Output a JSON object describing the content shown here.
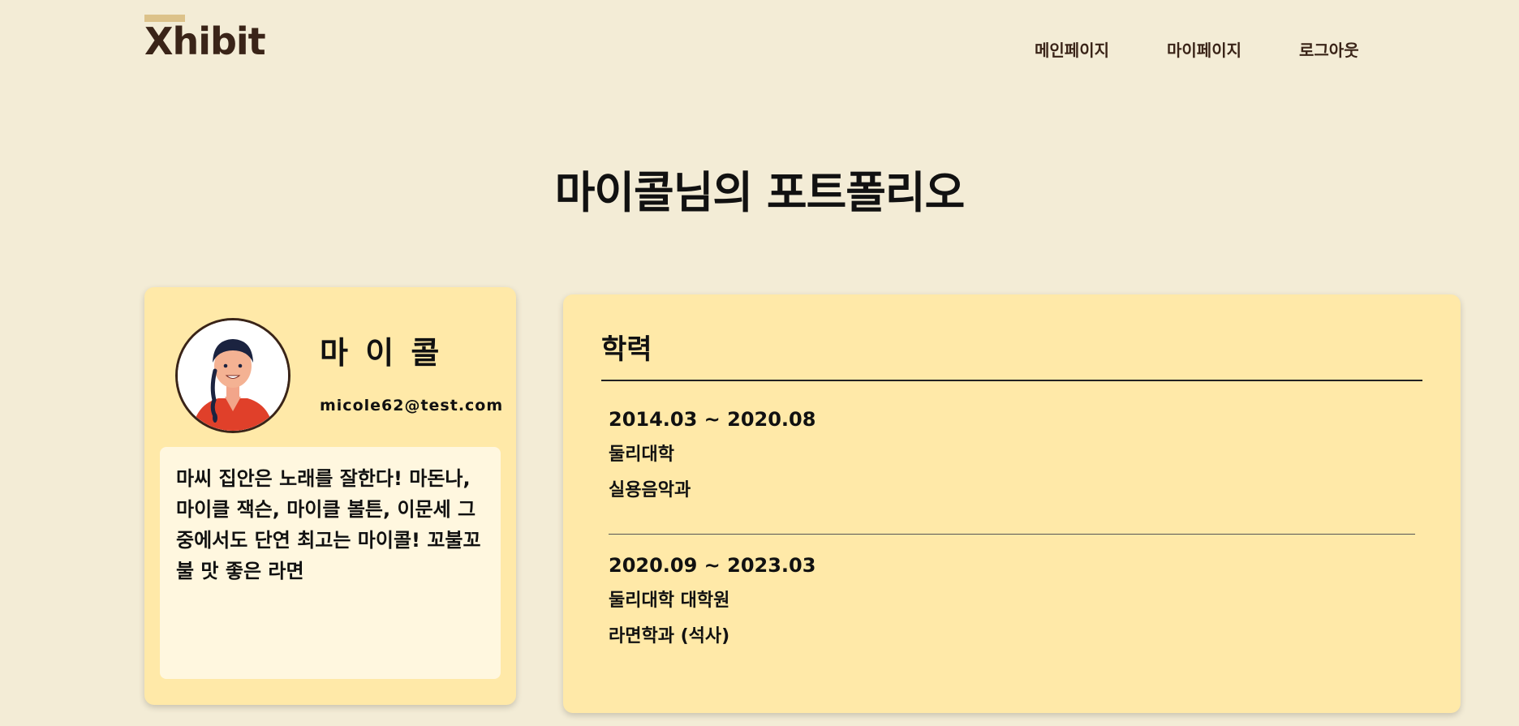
{
  "header": {
    "logo_text": "Xhibit",
    "nav": [
      "메인페이지",
      "마이페이지",
      "로그아웃"
    ]
  },
  "page_title": "마이콜님의 포트폴리오",
  "profile": {
    "name": "마 이 콜",
    "email": "micole62@test.com",
    "bio": "마씨 집안은 노래를 잘한다! 마돈나, 마이클 잭슨, 마이클 볼튼, 이문세 그 중에서도 단연 최고는 마이콜! 꼬불꼬불 맛 좋은 라면"
  },
  "education": {
    "title": "학력",
    "entries": [
      {
        "period": "2014.03 ~ 2020.08",
        "school": "둘리대학",
        "major": "실용음악과"
      },
      {
        "period": "2020.09 ~ 2023.03",
        "school": "둘리대학 대학원",
        "major": "라면학과 (석사)"
      }
    ]
  },
  "colors": {
    "background": "#f3ecd6",
    "card": "#ffe9a8",
    "bio_box": "#fff7df",
    "brand": "#3a2418",
    "logo_accent": "#dcc28a"
  }
}
